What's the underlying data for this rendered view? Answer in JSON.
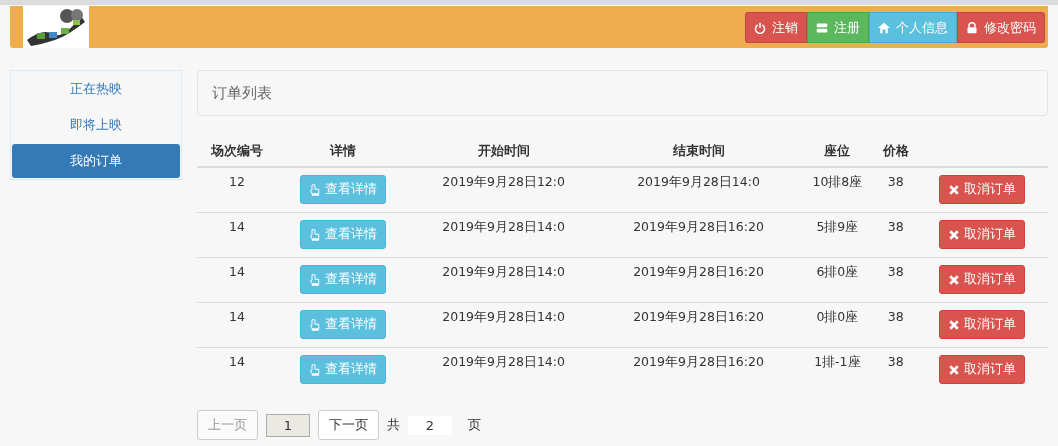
{
  "header": {
    "buttons": [
      {
        "label": "注销",
        "kind": "logout"
      },
      {
        "label": "注册",
        "kind": "register"
      },
      {
        "label": "个人信息",
        "kind": "profile"
      },
      {
        "label": "修改密码",
        "kind": "password"
      }
    ]
  },
  "sidebar": {
    "items": [
      {
        "label": "正在热映",
        "selected": false
      },
      {
        "label": "即将上映",
        "selected": false
      },
      {
        "label": "我的订单",
        "selected": true
      }
    ]
  },
  "panel": {
    "title": "订单列表"
  },
  "table": {
    "columns": [
      "场次编号",
      "详情",
      "开始时间",
      "结束时间",
      "座位",
      "价格"
    ],
    "rows": [
      {
        "session": "12",
        "details": "查看详情",
        "start": "2019年9月28日12:0",
        "end": "2019年9月28日14:0",
        "seat": "10排8座",
        "price": "38",
        "action": "取消订单"
      },
      {
        "session": "14",
        "details": "查看详情",
        "start": "2019年9月28日14:0",
        "end": "2019年9月28日16:20",
        "seat": "5排9座",
        "price": "38",
        "action": "取消订单"
      },
      {
        "session": "14",
        "details": "查看详情",
        "start": "2019年9月28日14:0",
        "end": "2019年9月28日16:20",
        "seat": "6排0座",
        "price": "38",
        "action": "取消订单"
      },
      {
        "session": "14",
        "details": "查看详情",
        "start": "2019年9月28日14:0",
        "end": "2019年9月28日16:20",
        "seat": "0排0座",
        "price": "38",
        "action": "取消订单"
      },
      {
        "session": "14",
        "details": "查看详情",
        "start": "2019年9月28日14:0",
        "end": "2019年9月28日16:20",
        "seat": "1排-1座",
        "price": "38",
        "action": "取消订单"
      }
    ]
  },
  "pagination": {
    "prev": {
      "label": "上一页",
      "disabled": true
    },
    "page": "1",
    "next": {
      "label": "下一页",
      "disabled": false
    },
    "total_prefix": "共",
    "total": "2",
    "total_suffix": "页"
  }
}
